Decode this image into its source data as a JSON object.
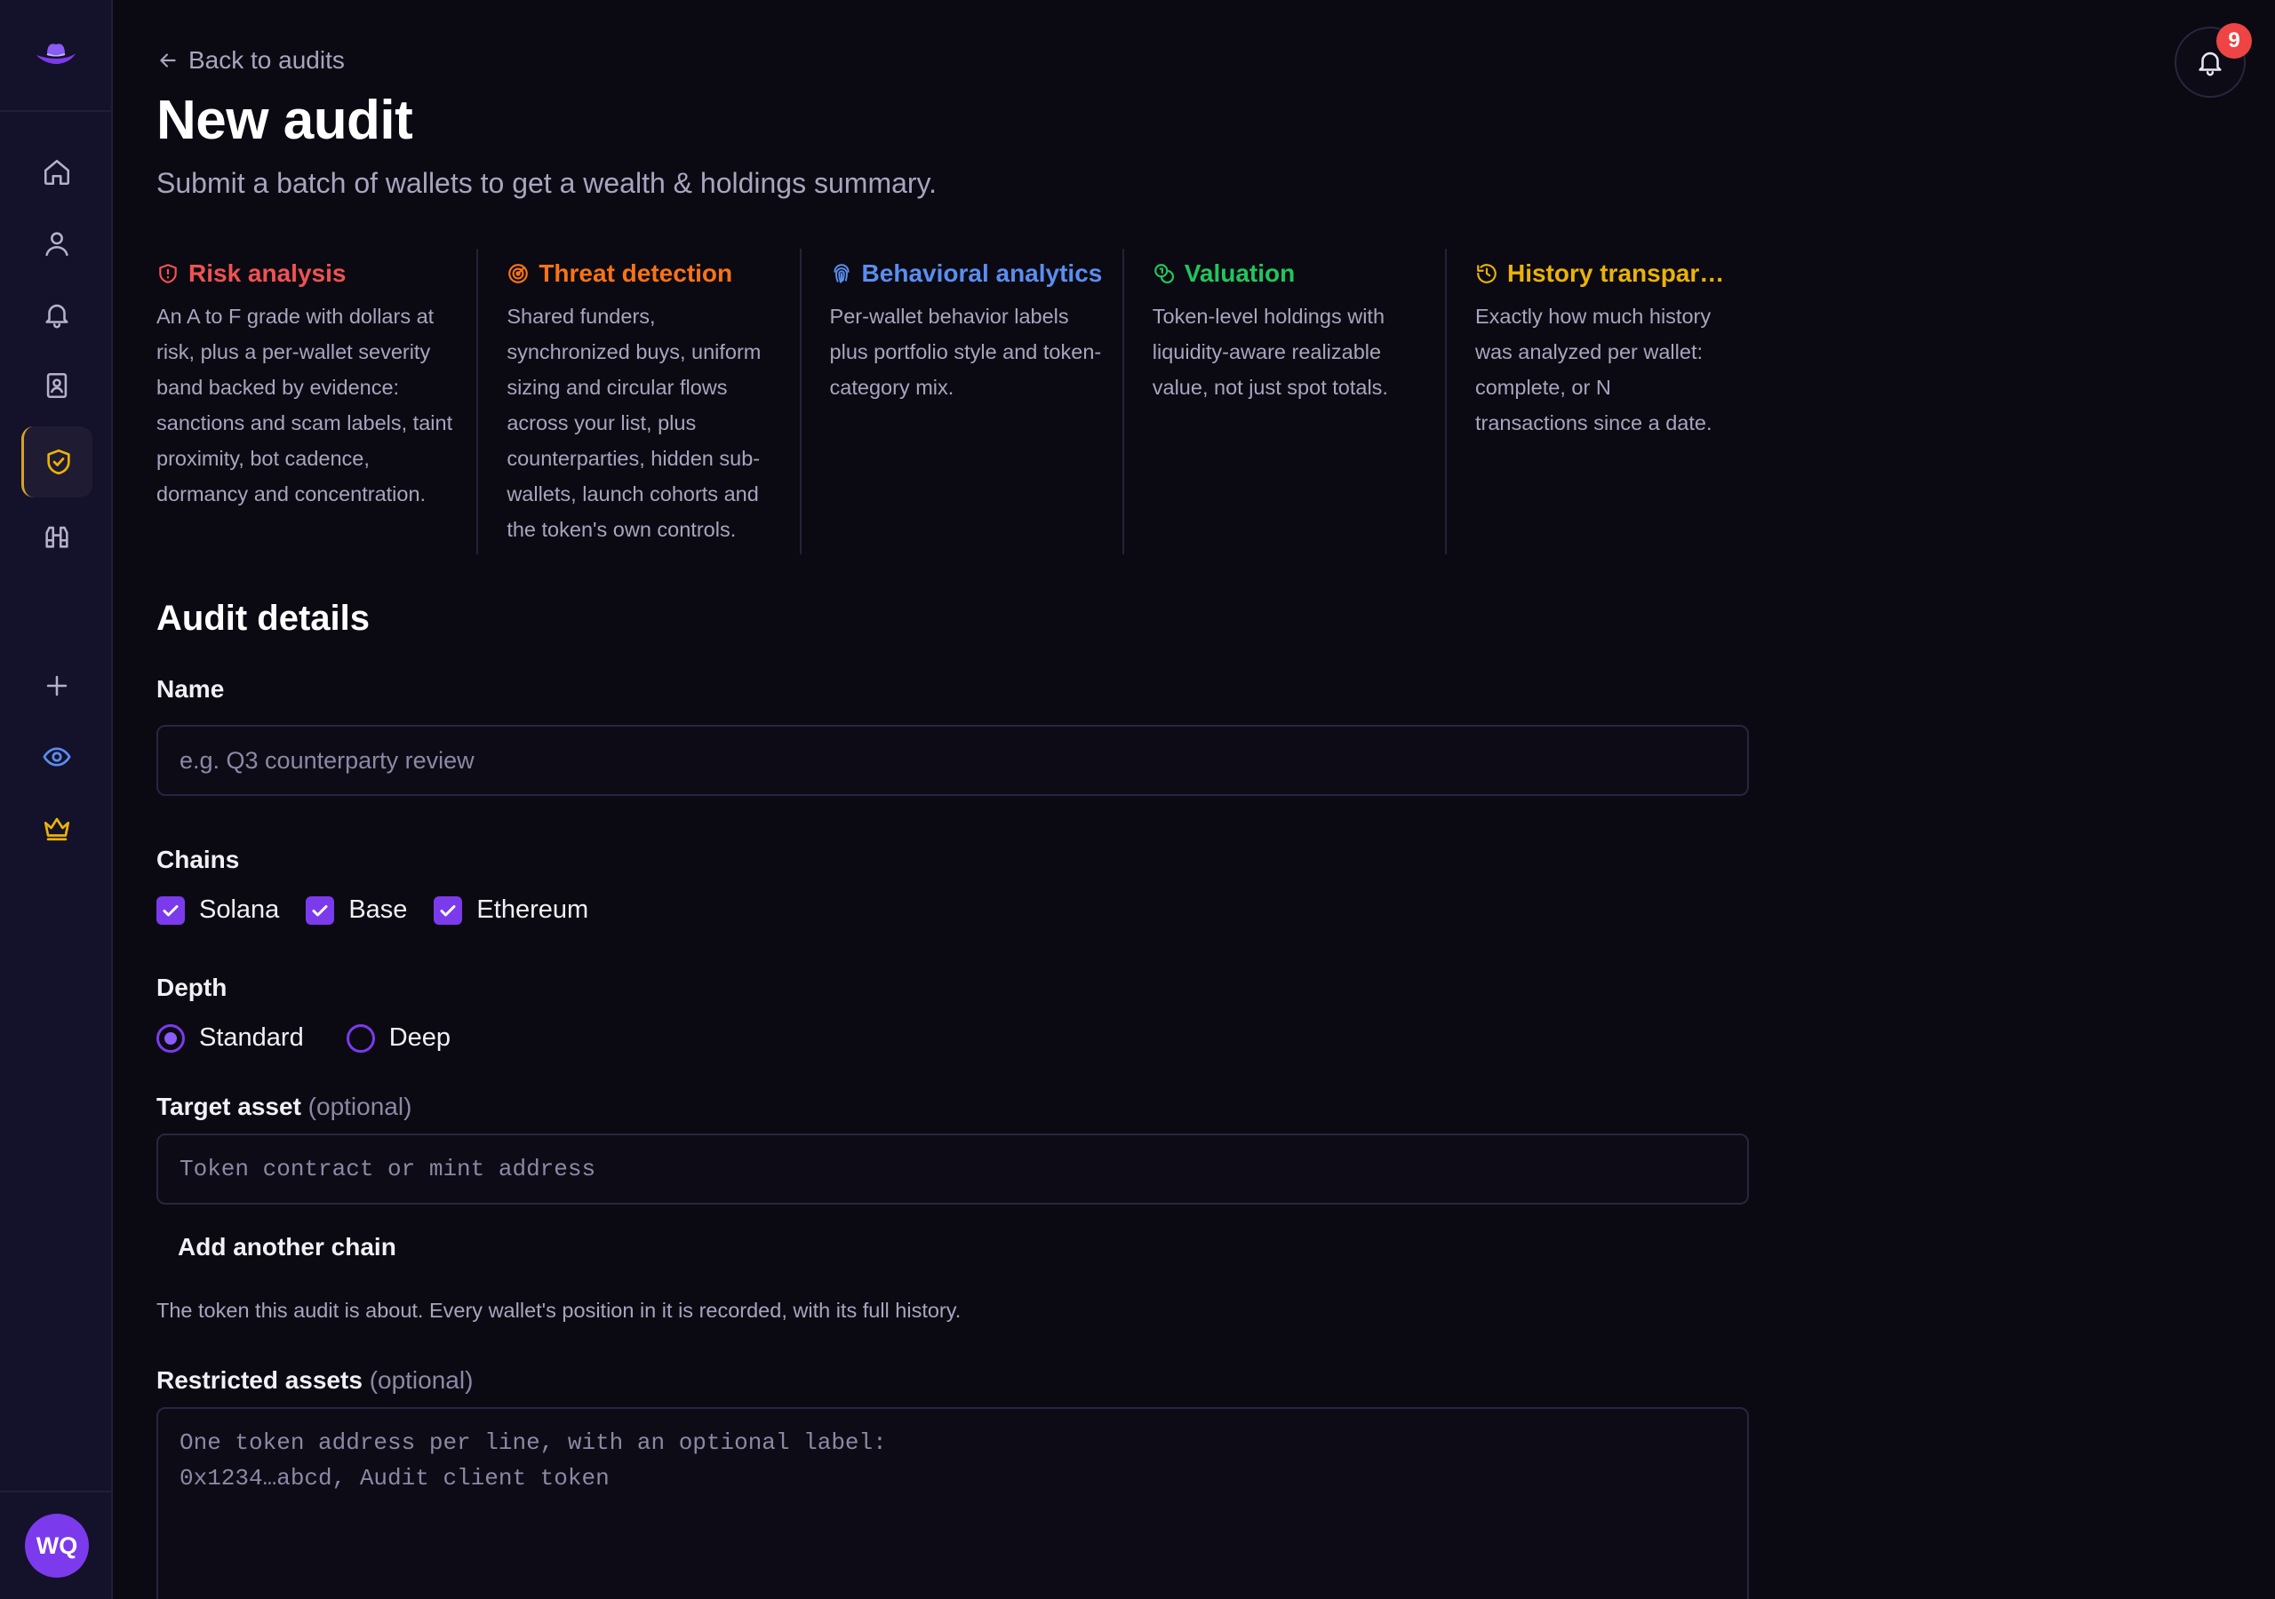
{
  "sidebar": {
    "logo_icon": "cowboy-hat-icon",
    "nav": [
      {
        "icon": "home-icon"
      },
      {
        "icon": "user-icon"
      },
      {
        "icon": "bell-icon"
      },
      {
        "icon": "contact-book-icon"
      },
      {
        "icon": "shield-check-icon",
        "active": true
      },
      {
        "icon": "binoculars-icon"
      },
      {
        "icon": "plus-icon"
      },
      {
        "icon": "eye-icon",
        "color": "#5b8def"
      },
      {
        "icon": "crown-icon",
        "color": "#eab308"
      }
    ],
    "avatar_initials": "WQ",
    "avatar_color": "#7c3aed"
  },
  "header": {
    "back_label": "Back to audits",
    "title": "New audit",
    "subtitle": "Submit a batch of wallets to get a wealth & holdings summary.",
    "notification_count": "9"
  },
  "features": [
    {
      "title": "Risk analysis",
      "color": "#f05252",
      "icon": "shield-alert-icon",
      "description": "An A to F grade with dollars at risk, plus a per-wallet severity band backed by evidence: sanctions and scam labels, taint proximity, bot cadence, dormancy and concentration."
    },
    {
      "title": "Threat detection",
      "color": "#f97316",
      "icon": "radar-icon",
      "description": "Shared funders, synchronized buys, uniform sizing and circular flows across your list, plus counterparties, hidden sub-wallets, launch cohorts and the token's own controls."
    },
    {
      "title": "Behavioral analytics",
      "color": "#5b8def",
      "icon": "fingerprint-icon",
      "description": "Per-wallet behavior labels plus portfolio style and token-category mix."
    },
    {
      "title": "Valuation",
      "color": "#22c55e",
      "icon": "coins-icon",
      "description": "Token-level holdings with liquidity-aware realizable value, not just spot totals."
    },
    {
      "title": "History transparen...",
      "color": "#eab308",
      "icon": "history-icon",
      "description": "Exactly how much history was analyzed per wallet: complete, or N transactions since a date."
    }
  ],
  "form": {
    "section_title": "Audit details",
    "name_label": "Name",
    "name_placeholder": "e.g. Q3 counterparty review",
    "chains_label": "Chains",
    "chains": [
      {
        "label": "Solana",
        "checked": true
      },
      {
        "label": "Base",
        "checked": true
      },
      {
        "label": "Ethereum",
        "checked": true
      }
    ],
    "depth_label": "Depth",
    "depth_options": [
      {
        "label": "Standard",
        "selected": true
      },
      {
        "label": "Deep",
        "selected": false
      }
    ],
    "target_label": "Target asset",
    "optional": "(optional)",
    "target_placeholder": "Token contract or mint address",
    "add_chain_label": "Add another chain",
    "target_help": "The token this audit is about. Every wallet's position in it is recorded, with its full history.",
    "restricted_label": "Restricted assets",
    "restricted_placeholder": "One token address per line, with an optional label:\n0x1234…abcd, Audit client token"
  },
  "colors": {
    "accent": "#7c3aed",
    "background": "#0b0a12",
    "sidebar": "#14112a",
    "badge": "#ef4444"
  }
}
